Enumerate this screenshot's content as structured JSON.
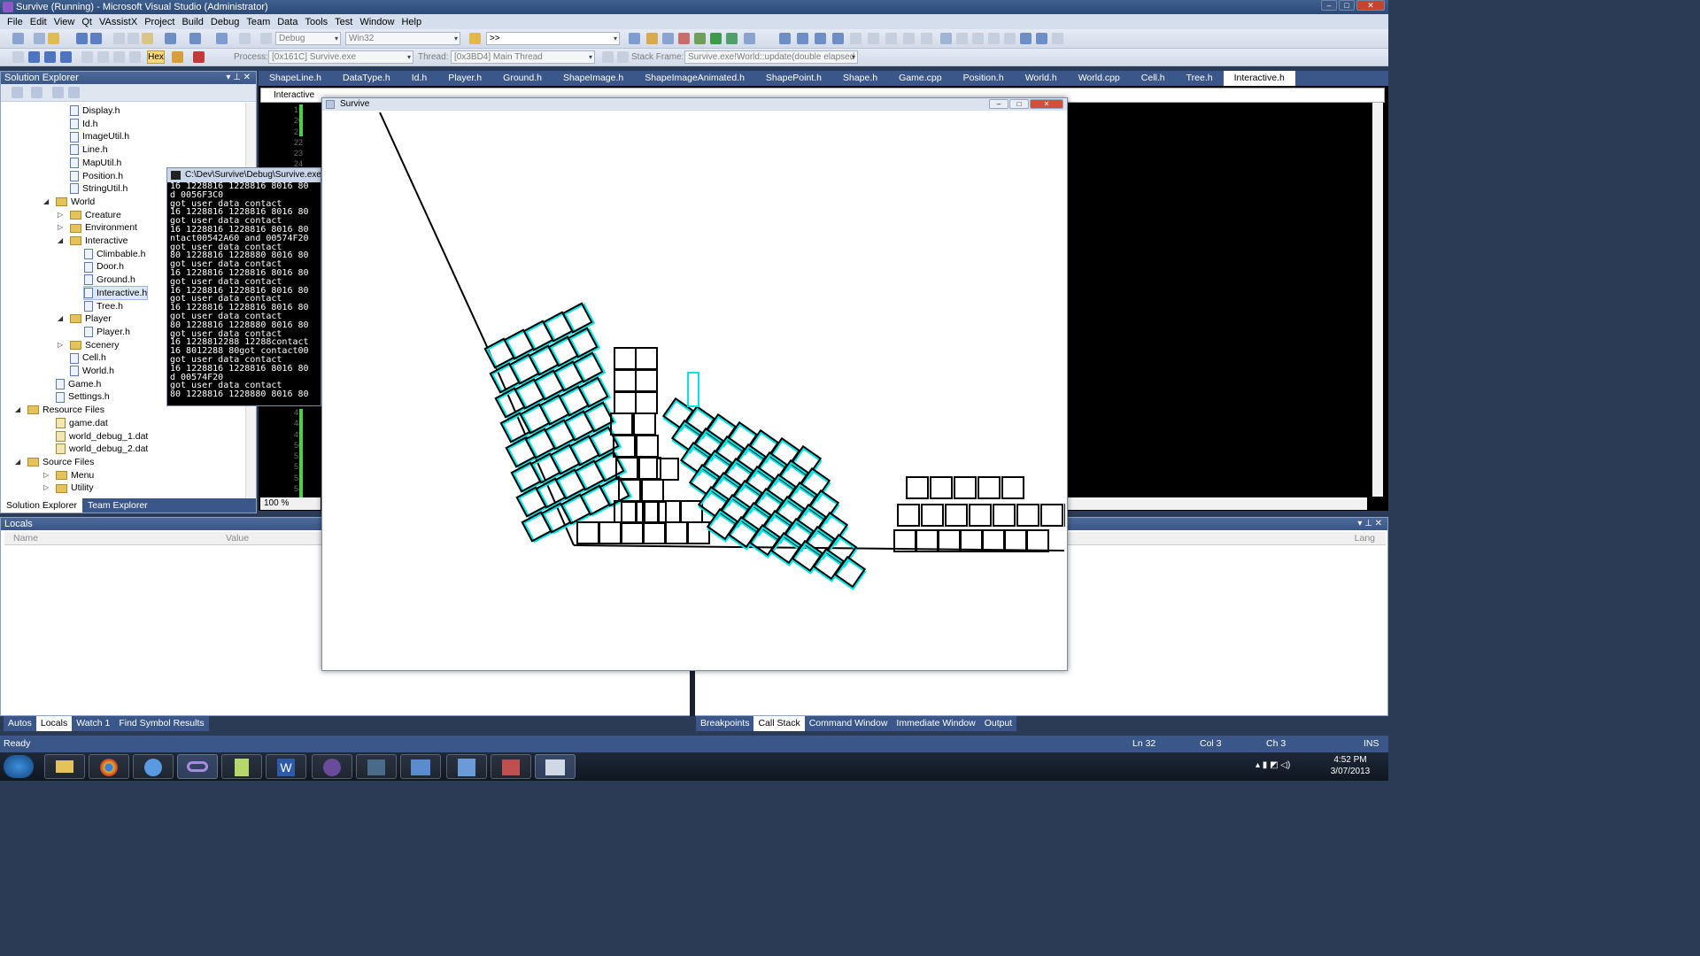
{
  "window": {
    "title": "Survive (Running) - Microsoft Visual Studio (Administrator)"
  },
  "menu": [
    "File",
    "Edit",
    "View",
    "Qt",
    "VAssistX",
    "Project",
    "Build",
    "Debug",
    "Team",
    "Data",
    "Tools",
    "Test",
    "Window",
    "Help"
  ],
  "toolbar": {
    "config": "Debug",
    "platform": "Win32",
    "find": ">>",
    "hex_label": "Hex",
    "process_label": "Process:",
    "process_value": "[0x161C] Survive.exe",
    "thread_label": "Thread:",
    "thread_value": "[0x3BD4] Main Thread",
    "stackframe_label": "Stack Frame:",
    "stackframe_value": "Survive.exe!World::update(double elapsed"
  },
  "solution_explorer": {
    "title": "Solution Explorer",
    "items": [
      {
        "label": "Display.h",
        "kind": "file",
        "indent": 5
      },
      {
        "label": "Id.h",
        "kind": "file",
        "indent": 5
      },
      {
        "label": "ImageUtil.h",
        "kind": "file",
        "indent": 5
      },
      {
        "label": "Line.h",
        "kind": "file",
        "indent": 5
      },
      {
        "label": "MapUtil.h",
        "kind": "file",
        "indent": 5
      },
      {
        "label": "Position.h",
        "kind": "file",
        "indent": 5
      },
      {
        "label": "StringUtil.h",
        "kind": "file",
        "indent": 5
      },
      {
        "label": "World",
        "kind": "folder",
        "indent": 4,
        "exp": "◢"
      },
      {
        "label": "Creature",
        "kind": "folder",
        "indent": 5,
        "exp": "▷"
      },
      {
        "label": "Environment",
        "kind": "folder",
        "indent": 5,
        "exp": "▷"
      },
      {
        "label": "Interactive",
        "kind": "folder",
        "indent": 5,
        "exp": "◢"
      },
      {
        "label": "Climbable.h",
        "kind": "file",
        "indent": 6
      },
      {
        "label": "Door.h",
        "kind": "file",
        "indent": 6
      },
      {
        "label": "Ground.h",
        "kind": "file",
        "indent": 6
      },
      {
        "label": "Interactive.h",
        "kind": "file",
        "indent": 6,
        "selected": true
      },
      {
        "label": "Tree.h",
        "kind": "file",
        "indent": 6
      },
      {
        "label": "Player",
        "kind": "folder",
        "indent": 5,
        "exp": "◢"
      },
      {
        "label": "Player.h",
        "kind": "file",
        "indent": 6
      },
      {
        "label": "Scenery",
        "kind": "folder",
        "indent": 5,
        "exp": "▷"
      },
      {
        "label": "Cell.h",
        "kind": "file",
        "indent": 5
      },
      {
        "label": "World.h",
        "kind": "file",
        "indent": 5
      },
      {
        "label": "Game.h",
        "kind": "file",
        "indent": 4
      },
      {
        "label": "Settings.h",
        "kind": "file",
        "indent": 4
      },
      {
        "label": "Resource Files",
        "kind": "folder",
        "indent": 2,
        "exp": "◢"
      },
      {
        "label": "game.dat",
        "kind": "dat",
        "indent": 4
      },
      {
        "label": "world_debug_1.dat",
        "kind": "dat",
        "indent": 4
      },
      {
        "label": "world_debug_2.dat",
        "kind": "dat",
        "indent": 4
      },
      {
        "label": "Source Files",
        "kind": "folder",
        "indent": 2,
        "exp": "◢"
      },
      {
        "label": "Menu",
        "kind": "folder",
        "indent": 4,
        "exp": "▷"
      },
      {
        "label": "Utility",
        "kind": "folder",
        "indent": 4,
        "exp": "▷"
      }
    ],
    "tabs": [
      "Solution Explorer",
      "Team Explorer"
    ]
  },
  "doc_tabs": [
    "ShapeLine.h",
    "DataType.h",
    "Id.h",
    "Player.h",
    "Ground.h",
    "ShapeImage.h",
    "ShapeImageAnimated.h",
    "ShapePoint.h",
    "Shape.h",
    "Game.cpp",
    "Position.h",
    "World.h",
    "World.cpp",
    "Cell.h",
    "Tree.h",
    "Interactive.h"
  ],
  "editor": {
    "header": "Interactive",
    "line_numbers_top": [
      "19",
      "20",
      "21",
      "22",
      "23",
      "24"
    ],
    "line_numbers_bottom": [
      "47",
      "48",
      "49",
      "50",
      "51",
      "52",
      "53",
      "54"
    ],
    "zoom": "100 %"
  },
  "console": {
    "title": "C:\\Dev\\Survive\\Debug\\Survive.exe",
    "lines": [
      "16 1228816 1228816 8016 80",
      "d 0056F3C0",
      "got user data contact",
      "16 1228816 1228816 8016 80",
      "got user data contact",
      "16 1228816 1228816 8016 80",
      "ntact00542A60 and 00574F20",
      "got user data contact",
      "80 1228816 1228880 8016 80",
      "got user data contact",
      "16 1228816 1228816 8016 80",
      "got user data contact",
      "16 1228816 1228816 8016 80",
      "got user data contact",
      "16 1228816 1228816 8016 80",
      "got user data contact",
      "80 1228816 1228880 8016 80",
      "got user data contact",
      "16 1228812288 12288contact",
      "16 8012288 80got contact00",
      "got user data contact",
      "16 1228816 1228816 8016 80",
      "d 00574F20",
      "got user data contact",
      "80 1228816 1228880 8016 80"
    ]
  },
  "game_window": {
    "title": "Survive"
  },
  "locals": {
    "title": "Locals",
    "columns": [
      "Name",
      "Value",
      "Lang"
    ]
  },
  "bottom_tabs_left": [
    "Autos",
    "Locals",
    "Watch 1",
    "Find Symbol Results"
  ],
  "bottom_tabs_right": [
    "Breakpoints",
    "Call Stack",
    "Command Window",
    "Immediate Window",
    "Output"
  ],
  "status": {
    "ready": "Ready",
    "line": "Ln 32",
    "col": "Col 3",
    "ch": "Ch 3",
    "mode": "INS"
  },
  "taskbar": {
    "time": "4:52 PM",
    "date": "3/07/2013"
  },
  "colors": {
    "box_outline": "#000000",
    "box_highlight": "#00e5e5",
    "accent": "#3b5789"
  }
}
